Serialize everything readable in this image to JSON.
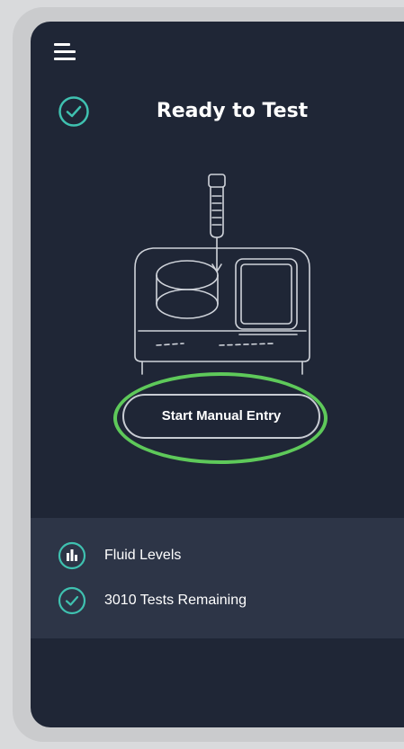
{
  "header": {
    "menu_icon": "hamburger-menu-icon",
    "status_icon": "check-circle-icon",
    "title": "Ready to Test"
  },
  "illustration": {
    "icon": "analyzer-device-with-pipette-illustration"
  },
  "actions": {
    "start_manual_entry_label": "Start Manual Entry",
    "highlight_color": "#5ec95a"
  },
  "status": {
    "items": [
      {
        "icon": "bar-chart-circle-icon",
        "label": "Fluid Levels"
      },
      {
        "icon": "check-circle-icon",
        "label": "3010 Tests Remaining"
      }
    ]
  },
  "colors": {
    "background": "#1f2636",
    "panel": "#2d3547",
    "accent_teal": "#3fc1b0",
    "highlight_green": "#5ec95a"
  }
}
